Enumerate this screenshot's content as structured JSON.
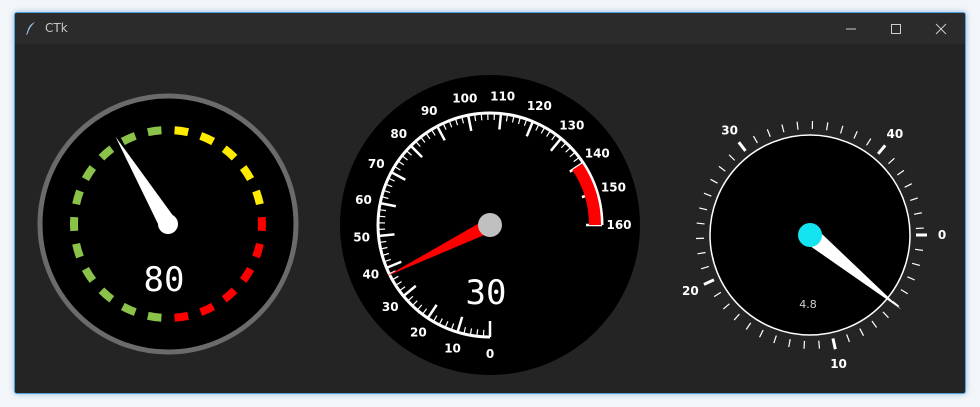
{
  "window": {
    "title": "CTk"
  },
  "gauges": {
    "left": {
      "value": "80",
      "needle_value": 80,
      "colors": {
        "green": "#8bc34a",
        "yellow": "#ffeb00",
        "red": "#ff0000",
        "ring": "#6b6b6b"
      }
    },
    "middle": {
      "value": "30",
      "needle_value": 30,
      "scale_labels": [
        "0",
        "10",
        "20",
        "30",
        "40",
        "50",
        "60",
        "70",
        "80",
        "90",
        "100",
        "110",
        "120",
        "130",
        "140",
        "150",
        "160"
      ],
      "colors": {
        "needle": "#ff0000",
        "redzone": "#ff0000",
        "hub": "#c0c0c0"
      }
    },
    "right": {
      "value": "4.8",
      "needle_value": 4.8,
      "scale_labels": [
        "0",
        "10",
        "20",
        "30",
        "40"
      ],
      "colors": {
        "hub": "#14e4f0",
        "needle": "#ffffff"
      }
    }
  }
}
